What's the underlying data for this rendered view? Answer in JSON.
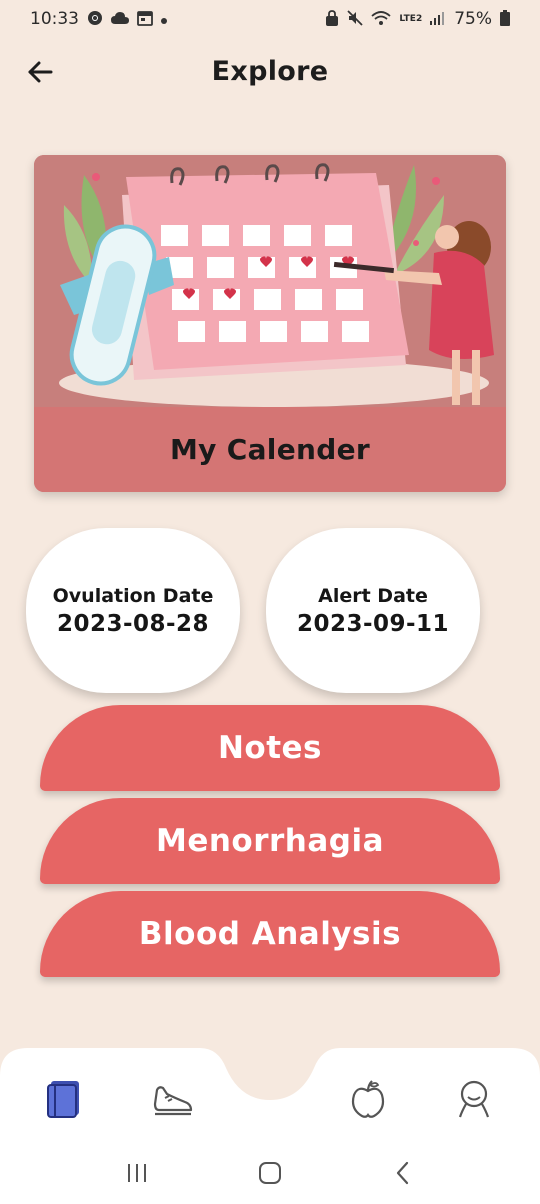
{
  "status_bar": {
    "time": "10:33",
    "battery": "75%",
    "network_label": "LTE2"
  },
  "header": {
    "title": "Explore"
  },
  "calendar_card": {
    "label": "My Calender"
  },
  "dates": {
    "ovulation_label": "Ovulation Date",
    "ovulation_value": "2023-08-28",
    "alert_label": "Alert Date",
    "alert_value": "2023-09-11"
  },
  "actions": {
    "notes": "Notes",
    "menorrhagia": "Menorrhagia",
    "blood_analysis": "Blood Analysis"
  },
  "bottom_nav": {
    "items": [
      "journal-icon",
      "sneaker-icon",
      "apple-icon",
      "profile-icon"
    ],
    "active": "journal-icon"
  },
  "colors": {
    "background": "#f6e9df",
    "accent": "#e66564",
    "card_label": "#d47574",
    "nav_active": "#3d4fb0"
  }
}
